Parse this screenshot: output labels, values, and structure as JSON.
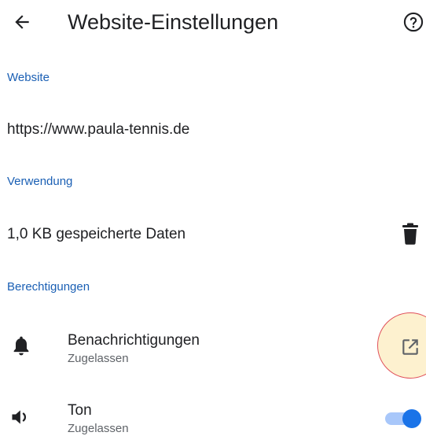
{
  "header": {
    "title": "Website-Einstellungen",
    "back_icon": "arrow-back-icon",
    "help_icon": "help-circle-icon"
  },
  "website_section": {
    "header": "Website",
    "url": "https://www.paula-tennis.de"
  },
  "usage_section": {
    "header": "Verwendung",
    "stored_data": "1,0 KB gespeicherte Daten",
    "delete_icon": "trash-icon"
  },
  "permissions_section": {
    "header": "Berechtigungen",
    "items": [
      {
        "title": "Benachrichtigungen",
        "status": "Zugelassen",
        "icon": "bell-icon",
        "action_icon": "open-external-icon"
      },
      {
        "title": "Ton",
        "status": "Zugelassen",
        "icon": "speaker-icon",
        "toggle_on": true
      }
    ]
  },
  "colors": {
    "accent": "#1a5fb4",
    "toggle_thumb": "#1a73e8",
    "toggle_track": "#a8c7fa",
    "highlight_fill": "#fdf1cf",
    "highlight_border": "#e0505a"
  }
}
